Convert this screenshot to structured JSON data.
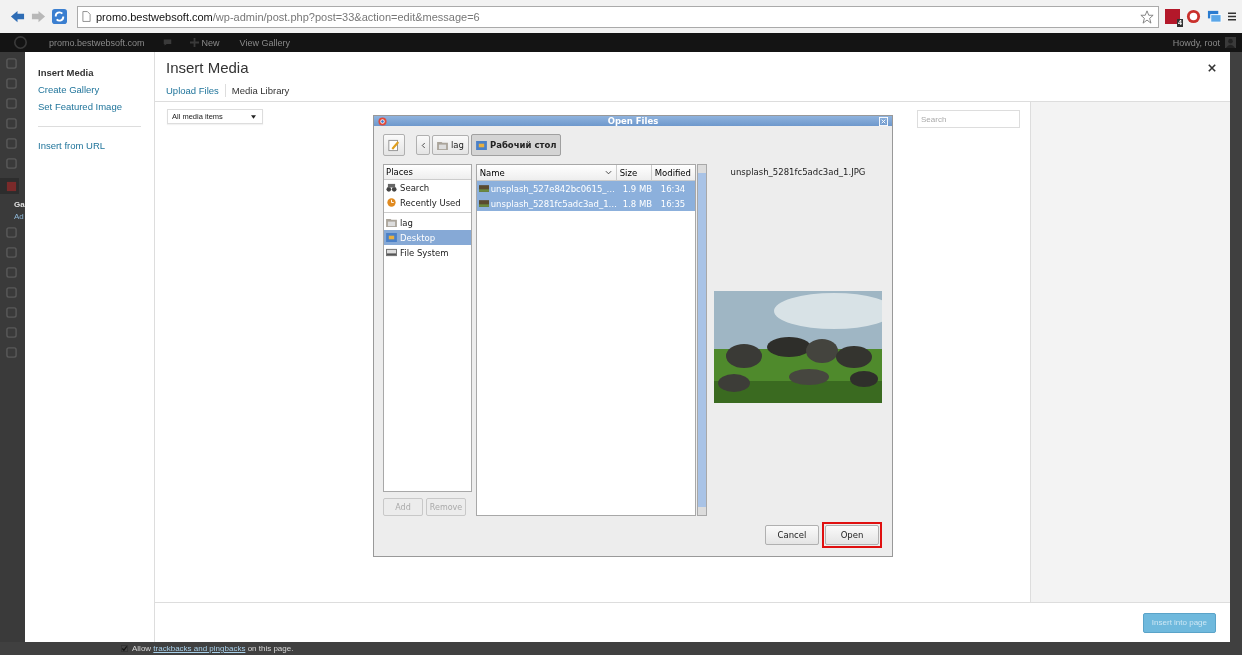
{
  "browser": {
    "url_host": "promo.bestwebsoft.com",
    "url_path": "/wp-admin/post.php?post=33&action=edit&message=6",
    "extension_badge": "4"
  },
  "admin_bar": {
    "site": "promo.bestwebsoft.com",
    "new": "New",
    "view": "View Gallery",
    "greeting": "Howdy, root"
  },
  "admin_menu": {
    "labels": [
      "Ga",
      "Ad"
    ]
  },
  "modal": {
    "menu": [
      {
        "label": "Insert Media",
        "selected": true
      },
      {
        "label": "Create Gallery",
        "selected": false
      },
      {
        "label": "Set Featured Image",
        "selected": false
      }
    ],
    "menu_extra": [
      {
        "label": "Insert from URL",
        "selected": false
      }
    ],
    "title": "Insert Media",
    "tabs": [
      {
        "label": "Upload Files",
        "selected": false
      },
      {
        "label": "Media Library",
        "selected": true
      }
    ],
    "filter": "All media items",
    "search": {
      "placeholder": "Search"
    },
    "insert_button": {
      "label": "Insert into page",
      "disabled": true
    }
  },
  "dialog": {
    "title": "Open Files",
    "path": [
      {
        "label": "lag",
        "selected": false,
        "kind": "folder"
      },
      {
        "label": "Рабочий стол",
        "selected": true,
        "kind": "desktop"
      }
    ],
    "places_header": "Places",
    "places_groups": [
      {
        "items": [
          {
            "label": "Search",
            "selected": false,
            "kind": "search"
          },
          {
            "label": "Recently Used",
            "selected": false,
            "kind": "recent"
          }
        ]
      },
      {
        "items": [
          {
            "label": "lag",
            "selected": false,
            "kind": "folder"
          },
          {
            "label": "Desktop",
            "selected": true,
            "kind": "desktop"
          },
          {
            "label": "File System",
            "selected": false,
            "kind": "drive"
          }
        ]
      }
    ],
    "add_button": {
      "label": "Add",
      "disabled": true
    },
    "remove_button": {
      "label": "Remove",
      "disabled": true
    },
    "columns": [
      "Name",
      "Size",
      "Modified"
    ],
    "files": [
      {
        "name": "unsplash_527e842bc0615_…",
        "size": "1.9 MB",
        "modified": "16:34",
        "selected": true
      },
      {
        "name": "unsplash_5281fc5adc3ad_1…",
        "size": "1.8 MB",
        "modified": "16:35",
        "selected": true
      }
    ],
    "preview_name": "unsplash_5281fc5adc3ad_1.JPG",
    "cancel": "Cancel",
    "open": {
      "label": "Open",
      "highlighted": true
    }
  },
  "footer_note": {
    "checked": true,
    "before": "Allow",
    "link": "trackbacks and pingbacks",
    "after": "on this page."
  }
}
